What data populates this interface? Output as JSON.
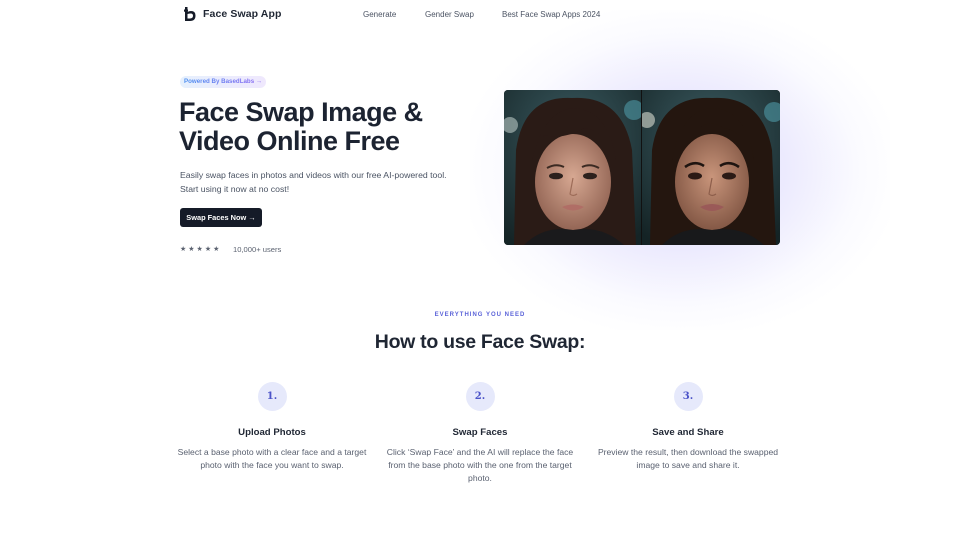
{
  "nav": {
    "brand": "Face Swap App",
    "links": [
      {
        "label": "Generate"
      },
      {
        "label": "Gender Swap"
      },
      {
        "label": "Best Face Swap Apps 2024"
      }
    ]
  },
  "hero": {
    "badge": "Powered By BasedLabs →",
    "title_line1": "Face Swap Image &",
    "title_line2": "Video Online Free",
    "desc_line1": "Easily swap faces in photos and videos with our free AI-powered tool.",
    "desc_line2": "Start using it now at no cost!",
    "cta": "Swap Faces Now →",
    "stars": "★★★★★",
    "rating": 5,
    "users": "10,000+ users"
  },
  "comparison": {
    "left_label": "original-face",
    "right_label": "swapped-face"
  },
  "how_to": {
    "eyebrow": "EVERYTHING YOU NEED",
    "title": "How to use Face Swap:",
    "steps": [
      {
        "num": "1.",
        "title": "Upload Photos",
        "desc": "Select a base photo with a clear face and a target photo with the face you want to swap."
      },
      {
        "num": "2.",
        "title": "Swap Faces",
        "desc": "Click ‘Swap Face’ and the AI will replace the face from the base photo with the one from the target photo."
      },
      {
        "num": "3.",
        "title": "Save and Share",
        "desc": "Preview the result, then download the swapped image to save and share it."
      }
    ]
  },
  "colors": {
    "accent": "#5a62d8",
    "cta_bg": "#151b28",
    "step_circle": "#e6e9fb",
    "heading": "#1f2633"
  }
}
